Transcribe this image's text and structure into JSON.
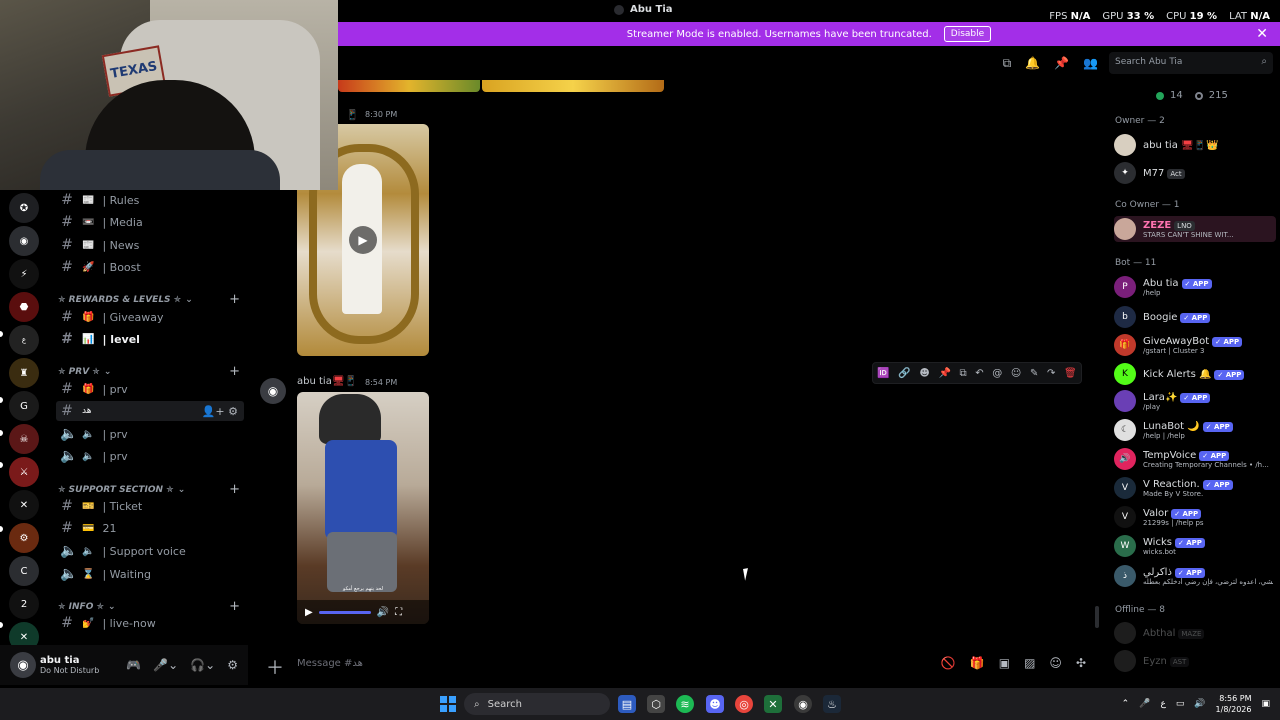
{
  "window": {
    "title": "Abu Tia"
  },
  "stats": [
    {
      "label": "FPS",
      "value": "N/A"
    },
    {
      "label": "GPU",
      "value": "33 %"
    },
    {
      "label": "CPU",
      "value": "19 %"
    },
    {
      "label": "LAT",
      "value": "N/A"
    }
  ],
  "streamer": {
    "message": "Streamer Mode is enabled. Usernames have been truncated.",
    "disable_label": "Disable"
  },
  "webcam": {
    "sign_text": "TEXAS"
  },
  "servers": [
    "",
    "",
    "",
    "",
    "",
    "",
    "",
    "",
    "",
    "",
    "",
    "C",
    "",
    "",
    ""
  ],
  "channels": {
    "top": [
      {
        "emoji": "📰",
        "name": "| Rules"
      },
      {
        "emoji": "📼",
        "name": "| Media"
      },
      {
        "emoji": "📰",
        "name": "| News"
      },
      {
        "emoji": "🚀",
        "name": "| Boost"
      }
    ],
    "cat_rewards": "✯ REWARDS & LEVELS ✯",
    "rewards": [
      {
        "emoji": "🎁",
        "name": "| Giveaway"
      },
      {
        "emoji": "📊",
        "name": "| level"
      }
    ],
    "cat_prv": "✯ PRV ✯",
    "prv": [
      {
        "emoji": "🎁",
        "name": "| prv"
      },
      {
        "emoji": "",
        "name": "هد"
      },
      {
        "emoji": "🔈",
        "name": "| prv"
      },
      {
        "emoji": "🔈",
        "name": "| prv"
      }
    ],
    "cat_support": "✯ SUPPORT SECTION ✯",
    "support": [
      {
        "emoji": "🎫",
        "name": "| Ticket"
      },
      {
        "emoji": "💳",
        "name": "21"
      },
      {
        "emoji": "🔈",
        "name": "| Support voice"
      },
      {
        "emoji": "⌛",
        "name": "| Waiting"
      }
    ],
    "cat_info": "✯ INFO ✯",
    "info": [
      {
        "emoji": "💅",
        "name": "| live-now"
      }
    ]
  },
  "user": {
    "name": "abu tia",
    "status": "Do Not Disturb"
  },
  "search": {
    "placeholder": "Search Abu Tia"
  },
  "messages": [
    {
      "time": "8:30 PM"
    },
    {
      "author": "abu tia",
      "time": "8:54 PM",
      "caption": "لحد يتهم يرجع أمكو"
    }
  ],
  "composer": {
    "placeholder": "Message #هد"
  },
  "members": {
    "online_count": "14",
    "offline_count": "215",
    "groups": [
      {
        "title": "Owner — 2"
      },
      {
        "title": "Co Owner — 1"
      },
      {
        "title": "Bot — 11"
      },
      {
        "title": "Offline — 8"
      }
    ],
    "owners": [
      {
        "name": "abu tia",
        "sub": ""
      },
      {
        "name": "M77",
        "sub": "",
        "tag": "Act"
      }
    ],
    "co_owners": [
      {
        "name": "ZEZE",
        "tag": "LNO",
        "sub": "STARS CAN'T SHINE WIT..."
      }
    ],
    "bots": [
      {
        "name": "Abu tia",
        "sub": "/help"
      },
      {
        "name": "Boogie",
        "sub": ""
      },
      {
        "name": "GiveAwayBot",
        "sub": "/gstart | Cluster 3"
      },
      {
        "name": "Kick Alerts 🔔",
        "sub": ""
      },
      {
        "name": "Lara✨",
        "sub": "/play"
      },
      {
        "name": "LunaBot 🌙",
        "sub": "/help | /help"
      },
      {
        "name": "TempVoice",
        "sub": "Creating Temporary Channels • /h..."
      },
      {
        "name": "V Reaction.",
        "sub": "Made By V Store."
      },
      {
        "name": "Valor",
        "sub": "21299s | /help ps"
      },
      {
        "name": "Wicks",
        "sub": "wicks.bot"
      },
      {
        "name": "ذاكرلي",
        "sub": "بشي، اعدوه لترضي، فإن رضي أدخلكم بعطله"
      }
    ],
    "app_label": "✓ APP",
    "offline": [
      {
        "name": "Abthal",
        "tag": "MAZE"
      },
      {
        "name": "Eyzn",
        "tag": "AST"
      }
    ]
  },
  "taskbar": {
    "search_label": "Search",
    "tray_lang": "ع",
    "time": "8:56 PM",
    "date": "1/8/2026"
  }
}
